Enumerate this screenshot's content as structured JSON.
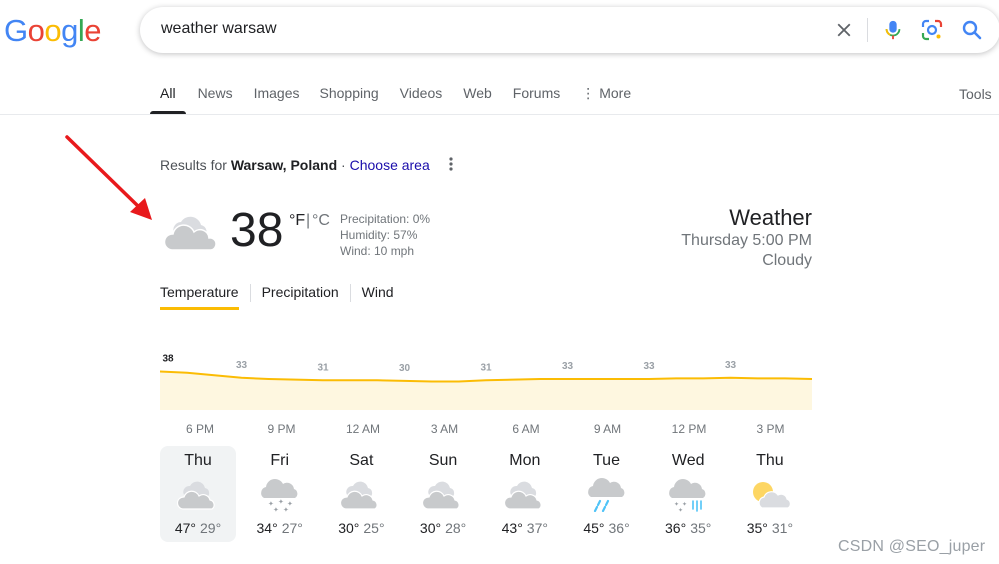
{
  "logo": {
    "letters": [
      "G",
      "o",
      "o",
      "g",
      "l",
      "e"
    ],
    "colors": [
      "#4285f4",
      "#ea4335",
      "#fbbc05",
      "#4285f4",
      "#34a853",
      "#ea4335"
    ]
  },
  "search": {
    "query": "weather warsaw"
  },
  "tabs": [
    {
      "label": "All",
      "active": true
    },
    {
      "label": "News"
    },
    {
      "label": "Images"
    },
    {
      "label": "Shopping"
    },
    {
      "label": "Videos"
    },
    {
      "label": "Web"
    },
    {
      "label": "Forums"
    },
    {
      "label": "More"
    }
  ],
  "tools_label": "Tools",
  "results_for": {
    "prefix": "Results for ",
    "location": "Warsaw, Poland",
    "separator": " · ",
    "choose_area": "Choose area"
  },
  "weather": {
    "temperature": "38",
    "unit_f": "°F",
    "unit_sep": "|",
    "unit_c": "°C",
    "precipitation": "Precipitation: 0%",
    "humidity": "Humidity: 57%",
    "wind": "Wind: 10 mph",
    "heading": "Weather",
    "time": "Thursday 5:00 PM",
    "condition": "Cloudy"
  },
  "chart_tabs": [
    "Temperature",
    "Precipitation",
    "Wind"
  ],
  "chart_data": {
    "type": "area",
    "series": [
      {
        "values": [
          38,
          37,
          35,
          33,
          32,
          31.5,
          31,
          31,
          31,
          30.5,
          30,
          30,
          31,
          31.5,
          32,
          32,
          32,
          32,
          32,
          32.5,
          32.5,
          33,
          32.5,
          32.5,
          32
        ]
      }
    ],
    "labeled_points": [
      {
        "index": 0,
        "label": "38"
      },
      {
        "index": 3,
        "label": "33"
      },
      {
        "index": 6,
        "label": "31"
      },
      {
        "index": 9,
        "label": "30"
      },
      {
        "index": 12,
        "label": "31"
      },
      {
        "index": 15,
        "label": "33"
      },
      {
        "index": 18,
        "label": "33"
      },
      {
        "index": 21,
        "label": "33"
      }
    ],
    "hour_labels": [
      "6 PM",
      "9 PM",
      "12 AM",
      "3 AM",
      "6 AM",
      "9 AM",
      "12 PM",
      "3 PM"
    ],
    "colors": {
      "line": "#fbbc04",
      "fill": "#fef7e0",
      "label_first": "#202124",
      "label": "#9aa0a6"
    }
  },
  "forecast": [
    {
      "day": "Thu",
      "hi": "47°",
      "lo": "29°",
      "icon": "cloudy-icon",
      "selected": true
    },
    {
      "day": "Fri",
      "hi": "34°",
      "lo": "27°",
      "icon": "snow-icon"
    },
    {
      "day": "Sat",
      "hi": "30°",
      "lo": "25°",
      "icon": "cloudy-icon"
    },
    {
      "day": "Sun",
      "hi": "30°",
      "lo": "28°",
      "icon": "cloudy-icon"
    },
    {
      "day": "Mon",
      "hi": "43°",
      "lo": "37°",
      "icon": "cloudy-icon"
    },
    {
      "day": "Tue",
      "hi": "45°",
      "lo": "36°",
      "icon": "rain-icon"
    },
    {
      "day": "Wed",
      "hi": "36°",
      "lo": "35°",
      "icon": "rain-snow-icon"
    },
    {
      "day": "Thu",
      "hi": "35°",
      "lo": "31°",
      "icon": "partly-cloudy-icon"
    }
  ],
  "watermark": "CSDN @SEO_juper"
}
